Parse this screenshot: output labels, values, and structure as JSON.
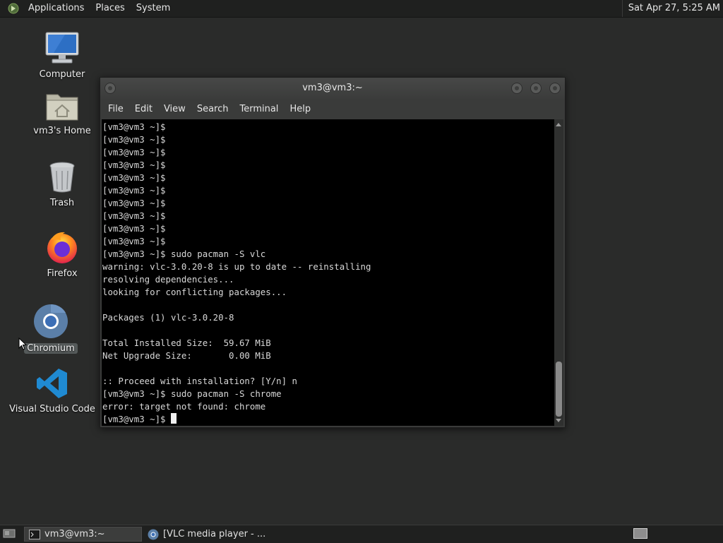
{
  "top_panel": {
    "menus": [
      "Applications",
      "Places",
      "System"
    ],
    "clock": "Sat Apr 27,  5:25 AM"
  },
  "desktop_icons": [
    {
      "label": "Computer",
      "icon": "computer-icon"
    },
    {
      "label": "vm3's Home",
      "icon": "home-folder-icon"
    },
    {
      "label": "Trash",
      "icon": "trash-icon"
    },
    {
      "label": "Firefox",
      "icon": "firefox-icon"
    },
    {
      "label": "Chromium",
      "icon": "chromium-icon"
    },
    {
      "label": "Visual Studio Code",
      "icon": "vscode-icon"
    }
  ],
  "terminal_window": {
    "title": "vm3@vm3:~",
    "menus": [
      "File",
      "Edit",
      "View",
      "Search",
      "Terminal",
      "Help"
    ],
    "output": "[vm3@vm3 ~]$\n[vm3@vm3 ~]$\n[vm3@vm3 ~]$\n[vm3@vm3 ~]$\n[vm3@vm3 ~]$\n[vm3@vm3 ~]$\n[vm3@vm3 ~]$\n[vm3@vm3 ~]$\n[vm3@vm3 ~]$\n[vm3@vm3 ~]$\n[vm3@vm3 ~]$ sudo pacman -S vlc\nwarning: vlc-3.0.20-8 is up to date -- reinstalling\nresolving dependencies...\nlooking for conflicting packages...\n\nPackages (1) vlc-3.0.20-8\n\nTotal Installed Size:  59.67 MiB\nNet Upgrade Size:       0.00 MiB\n\n:: Proceed with installation? [Y/n] n\n[vm3@vm3 ~]$ sudo pacman -S chrome\nerror: target not found: chrome\n",
    "prompt": "[vm3@vm3 ~]$ "
  },
  "taskbar": {
    "tasks": [
      {
        "label": "vm3@vm3:~",
        "icon": "terminal-icon",
        "active": true
      },
      {
        "label": "[VLC media player - ...",
        "icon": "chromium-icon",
        "active": false
      }
    ]
  }
}
